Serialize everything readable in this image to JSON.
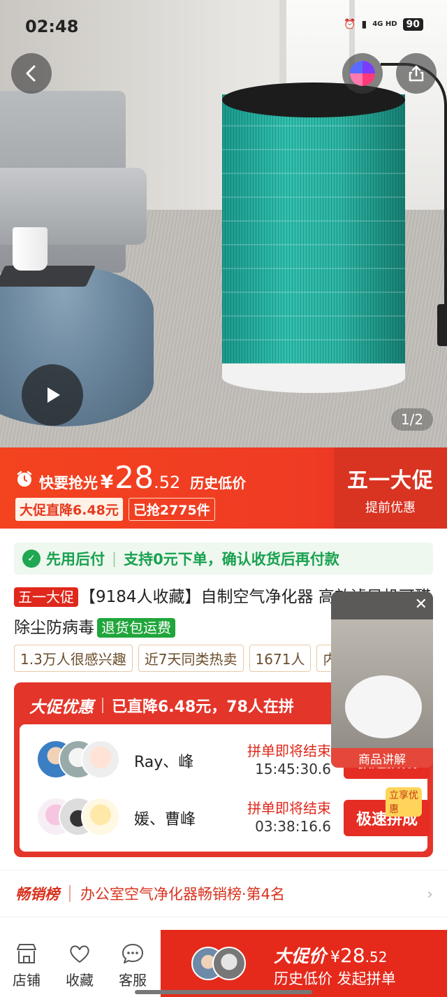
{
  "status_bar": {
    "time": "02:48",
    "network": "4G HD",
    "battery": "90"
  },
  "gallery": {
    "counter": "1/2",
    "icons": [
      "back-arrow",
      "share",
      "play"
    ]
  },
  "price_banner": {
    "flash_label": "快要抢光",
    "currency": "¥",
    "price_int": "28",
    "price_dec": ".52",
    "history_low": "历史低价",
    "drop_tag": "大促直降6.48元",
    "sold_tag": "已抢2775件",
    "promo_title": "五一大促",
    "promo_sub": "提前优惠",
    "accent": "#f3431f"
  },
  "pay_later": {
    "label": "先用后付",
    "detail": "支持0元下单，确认收货后再付款"
  },
  "product": {
    "promo_badge": "五一大促",
    "title": "【9184人收藏】自制空气净化器 高效滤风机可醛除尘防病毒",
    "return_badge": "退货包运费"
  },
  "interest_tags": [
    "1.3万人很感兴趣",
    "近7天同类热卖",
    "1671人",
    "内1"
  ],
  "group_buy": {
    "brand": "大促优惠",
    "headline": "已直降6.48元，78人在拼",
    "rows": [
      {
        "names": "Ray、峰",
        "ends": "拼单即将结束",
        "timer": "15:45:30.6",
        "button": "极速拼成",
        "badge": ""
      },
      {
        "names": "媛、曹峰",
        "ends": "拼单即将结束",
        "timer": "03:38:16.6",
        "button": "极速拼成",
        "badge": "立享优惠"
      }
    ]
  },
  "video_popup": {
    "label": "商品讲解"
  },
  "ranking": {
    "badge": "畅销榜",
    "text": "办公室空气净化器畅销榜·第4名"
  },
  "bottom_bar": {
    "store": "店铺",
    "favorite": "收藏",
    "service": "客服",
    "cta_brand": "大促价",
    "cta_currency": "¥",
    "cta_int": "28",
    "cta_dec": ".52",
    "cta_sub": "历史低价 发起拼单"
  }
}
